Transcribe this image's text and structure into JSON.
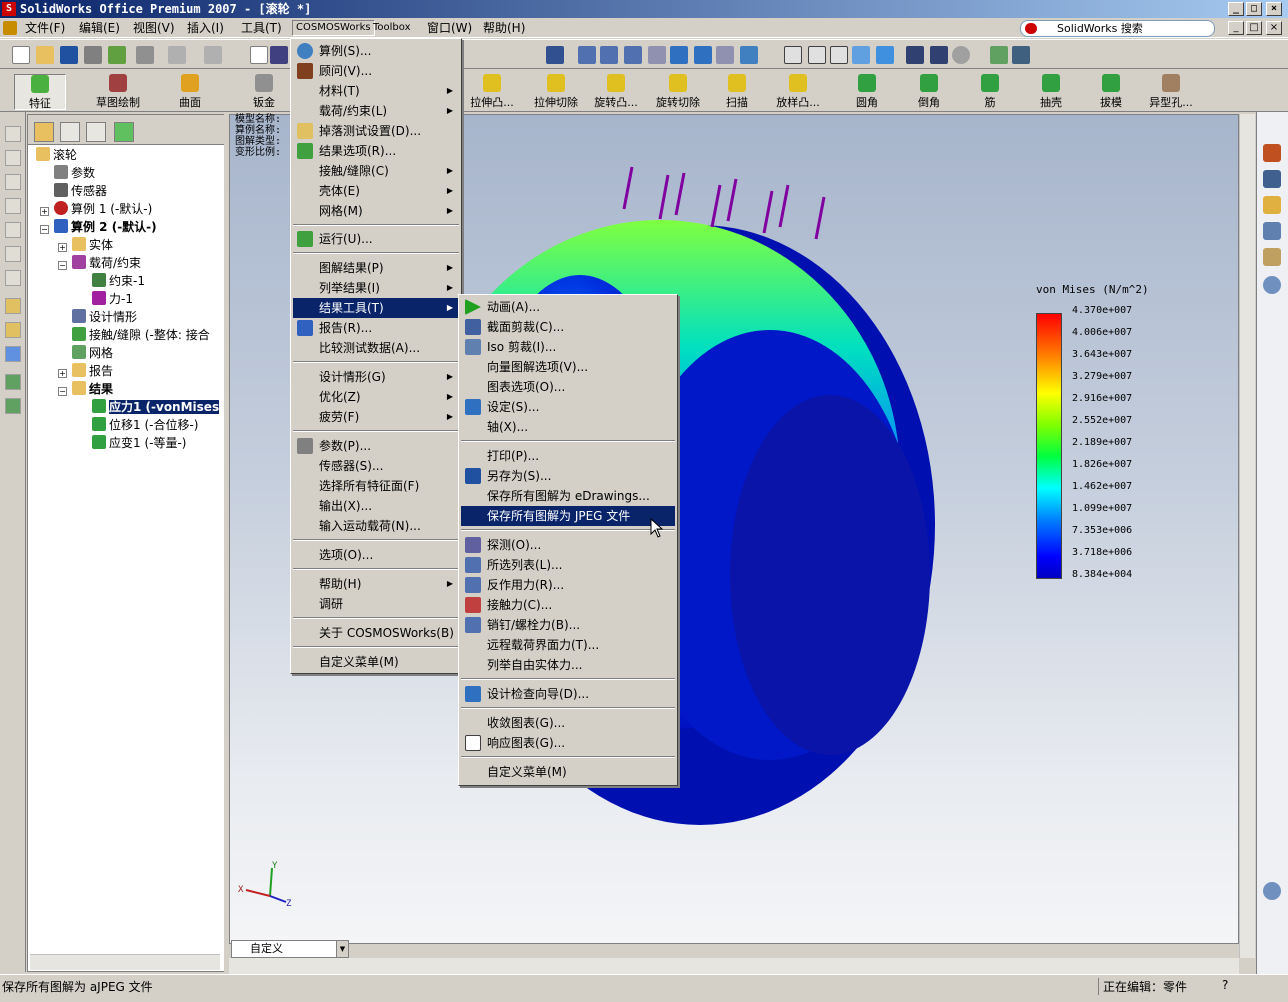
{
  "window": {
    "title": "SolidWorks Office Premium 2007 - [滚轮 *]",
    "min": "_",
    "max": "□",
    "close": "×",
    "doc_min": "_",
    "doc_max": "□",
    "doc_close": "×"
  },
  "menubar": {
    "items": [
      "文件(F)",
      "编辑(E)",
      "视图(V)",
      "插入(I)",
      "工具(T)",
      "COSMOSWorks",
      "Toolbox",
      "窗口(W)",
      "帮助(H)"
    ],
    "search": "SolidWorks 搜索"
  },
  "command_manager": {
    "buttons": [
      "特征",
      "草图绘制",
      "曲面",
      "钣金",
      "拉伸凸...",
      "拉伸切除",
      "旋转凸...",
      "旋转切除",
      "扫描",
      "放样凸...",
      "圆角",
      "倒角",
      "筋",
      "抽壳",
      "拔模",
      "异型孔..."
    ]
  },
  "feature_tree": {
    "items": [
      {
        "label": "滚轮",
        "bold": false
      },
      {
        "label": "参数",
        "bold": false
      },
      {
        "label": "传感器",
        "bold": false
      },
      {
        "label": "算例 1 (-默认-)",
        "bold": false
      },
      {
        "label": "算例 2 (-默认-)",
        "bold": true
      },
      {
        "label": "实体",
        "bold": false
      },
      {
        "label": "载荷/约束",
        "bold": false
      },
      {
        "label": "约束-1",
        "bold": false
      },
      {
        "label": "力-1",
        "bold": false
      },
      {
        "label": "设计情形",
        "bold": false
      },
      {
        "label": "接触/缝隙 (-整体: 接合",
        "bold": false
      },
      {
        "label": "网格",
        "bold": false
      },
      {
        "label": "报告",
        "bold": false
      },
      {
        "label": "结果",
        "bold": true
      },
      {
        "label": "应力1 (-vonMises",
        "bold": true
      },
      {
        "label": "位移1 (-合位移-)",
        "bold": false
      },
      {
        "label": "应变1 (-等量-)",
        "bold": false
      }
    ]
  },
  "viewport": {
    "info_labels": [
      "模型名称:",
      "算例名称:",
      "图解类型:",
      "变形比例:"
    ],
    "legend": {
      "title": "von Mises (N/m^2)",
      "values": [
        "4.370e+007",
        "4.006e+007",
        "3.643e+007",
        "3.279e+007",
        "2.916e+007",
        "2.552e+007",
        "2.189e+007",
        "1.826e+007",
        "1.462e+007",
        "1.099e+007",
        "7.353e+006",
        "3.718e+006",
        "8.384e+004"
      ]
    },
    "triad": {
      "x": "X",
      "y": "Y",
      "z": "Z"
    },
    "view_combo": "自定义"
  },
  "cosmos_menu": {
    "items": [
      {
        "label": "算例(S)...",
        "submenu": false
      },
      {
        "label": "顾问(V)...",
        "submenu": false
      },
      {
        "label": "材料(T)",
        "submenu": true
      },
      {
        "label": "载荷/约束(L)",
        "submenu": true
      },
      {
        "label": "掉落测试设置(D)...",
        "submenu": false
      },
      {
        "label": "结果选项(R)...",
        "submenu": false
      },
      {
        "label": "接触/缝隙(C)",
        "submenu": true
      },
      {
        "label": "壳体(E)",
        "submenu": true
      },
      {
        "label": "网格(M)",
        "submenu": true
      },
      {
        "label": "运行(U)...",
        "submenu": false
      },
      {
        "label": "图解结果(P)",
        "submenu": true
      },
      {
        "label": "列举结果(I)",
        "submenu": true
      },
      {
        "label": "结果工具(T)",
        "submenu": true
      },
      {
        "label": "报告(R)...",
        "submenu": false
      },
      {
        "label": "比较测试数据(A)...",
        "submenu": false
      },
      {
        "label": "设计情形(G)",
        "submenu": true
      },
      {
        "label": "优化(Z)",
        "submenu": true
      },
      {
        "label": "疲劳(F)",
        "submenu": true
      },
      {
        "label": "参数(P)...",
        "submenu": false
      },
      {
        "label": "传感器(S)...",
        "submenu": false
      },
      {
        "label": "选择所有特征面(F)",
        "submenu": false
      },
      {
        "label": "输出(X)...",
        "submenu": false
      },
      {
        "label": "输入运动载荷(N)...",
        "submenu": false
      },
      {
        "label": "选项(O)...",
        "submenu": false
      },
      {
        "label": "帮助(H)",
        "submenu": true
      },
      {
        "label": "调研",
        "submenu": false
      },
      {
        "label": "关于 COSMOSWorks(B)",
        "submenu": false
      },
      {
        "label": "自定义菜单(M)",
        "submenu": false
      }
    ]
  },
  "result_tools_menu": {
    "items": [
      "动画(A)...",
      "截面剪裁(C)...",
      "Iso 剪裁(I)...",
      "向量图解选项(V)...",
      "图表选项(O)...",
      "设定(S)...",
      "轴(X)...",
      "打印(P)...",
      "另存为(S)...",
      "保存所有图解为 eDrawings...",
      "保存所有图解为 JPEG 文件",
      "探测(O)...",
      "所选列表(L)...",
      "反作用力(R)...",
      "接触力(C)...",
      "销钉/螺栓力(B)...",
      "远程载荷界面力(T)...",
      "列举自由实体力...",
      "设计检查向导(D)...",
      "收敛图表(G)...",
      "响应图表(G)...",
      "自定义菜单(M)"
    ]
  },
  "statusbar": {
    "message": "保存所有图解为 aJPEG 文件",
    "editing": "正在编辑：零件",
    "help": "?"
  },
  "colors": {
    "selection": "#0a246a",
    "title_start": "#0a246a",
    "title_end": "#a6caf0",
    "arrow": "#800080"
  }
}
